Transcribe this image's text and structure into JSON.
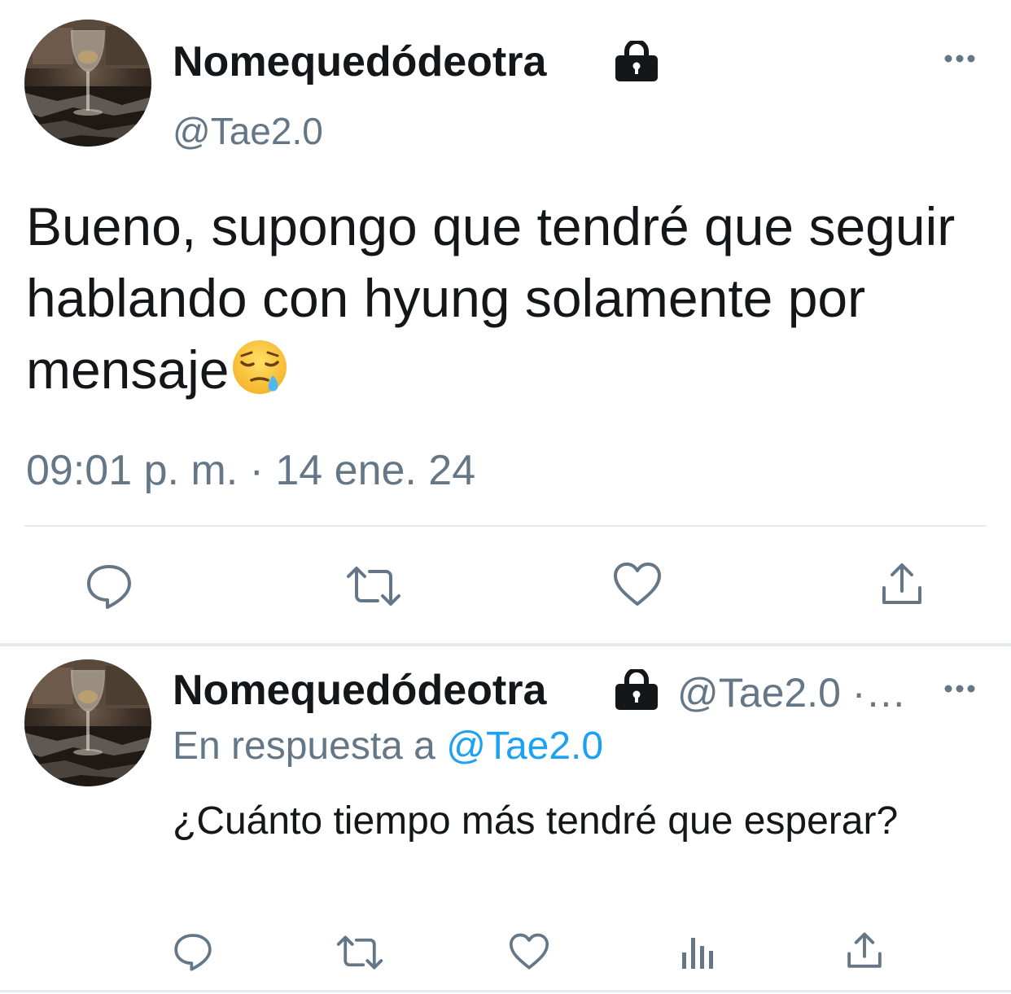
{
  "main_tweet": {
    "display_name": "Nomequedódeotra",
    "handle": "@Tae2.0",
    "protected_icon": "lock-icon",
    "more_icon": "more-horizontal-icon",
    "text": "Bueno, supongo que tendré que seguir hablando con hyung solamente por mensaje",
    "emoji": "sleepy-face-emoji",
    "timestamp": "09:01 p. m. · 14 ene. 24",
    "actions": {
      "reply_icon": "reply-icon",
      "retweet_icon": "retweet-icon",
      "like_icon": "heart-icon",
      "share_icon": "share-icon"
    }
  },
  "reply_tweet": {
    "display_name": "Nomequedódeotra",
    "handle_meta": "@Tae2.0 ·…",
    "protected_icon": "lock-icon",
    "more_icon": "more-horizontal-icon",
    "reply_prefix": "En respuesta a",
    "reply_mention": "@Tae2.0",
    "text": "¿Cuánto tiempo más tendré que esperar?",
    "actions": {
      "reply_icon": "reply-icon",
      "retweet_icon": "retweet-icon",
      "like_icon": "heart-icon",
      "analytics_icon": "analytics-icon",
      "share_icon": "share-icon"
    }
  },
  "colors": {
    "text_primary": "#14171a",
    "text_secondary": "#657786",
    "link": "#1da1f2",
    "icon": "#657786",
    "divider": "#e6ecf0"
  }
}
